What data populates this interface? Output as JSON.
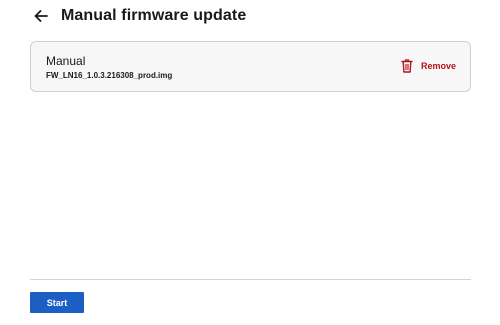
{
  "header": {
    "back_icon": "arrow-left-icon",
    "title": "Manual firmware update"
  },
  "file_card": {
    "type_label": "Manual",
    "file_name": "FW_LN16_1.0.3.216308_prod.img",
    "remove": {
      "icon": "trash-icon",
      "label": "Remove",
      "color": "#b5121b"
    }
  },
  "footer": {
    "start_label": "Start",
    "start_color": "#1b5ec4"
  }
}
